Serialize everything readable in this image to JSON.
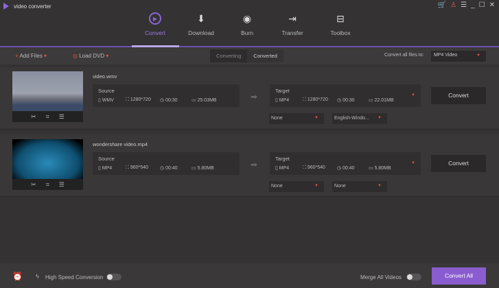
{
  "app": {
    "title": "video converter"
  },
  "nav": [
    {
      "label": "Convert"
    },
    {
      "label": "Download"
    },
    {
      "label": "Burn"
    },
    {
      "label": "Transfer"
    },
    {
      "label": "Toolbox"
    }
  ],
  "toolbar": {
    "add_files": "Add Files",
    "load_dvd": "Load DVD",
    "tabs": [
      "Converting",
      "Converted"
    ],
    "convert_all_label": "Convert all files to:",
    "format": "MP4 Video"
  },
  "files": [
    {
      "name": "video.wmv",
      "source_label": "Source",
      "source": {
        "format": "WMV",
        "resolution": "1280*720",
        "duration": "00:30",
        "size": "25.03MB"
      },
      "target_label": "Target",
      "target": {
        "format": "MP4",
        "resolution": "1280*720",
        "duration": "00:30",
        "size": "22.01MB"
      },
      "subtitle": "None",
      "audio": "English-Windo...",
      "convert": "Convert"
    },
    {
      "name": "wondershare video.mp4",
      "source_label": "Source",
      "source": {
        "format": "MP4",
        "resolution": "960*540",
        "duration": "00:40",
        "size": "5.80MB"
      },
      "target_label": "Target",
      "target": {
        "format": "MP4",
        "resolution": "960*540",
        "duration": "00:40",
        "size": "5.80MB"
      },
      "subtitle": "None",
      "audio": "None",
      "convert": "Convert"
    }
  ],
  "bottom": {
    "high_speed": "High Speed Conversion",
    "merge": "Merge All Videos",
    "convert_all": "Convert All"
  },
  "colors": {
    "accent": "#8a5cd0",
    "red": "#e0564a"
  }
}
